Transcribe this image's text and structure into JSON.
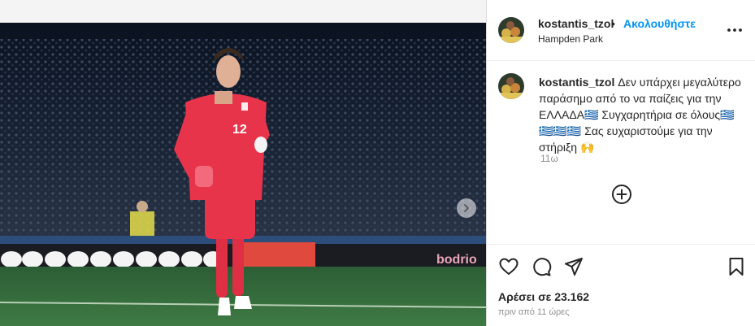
{
  "post": {
    "username": "kostantis_tzol",
    "separator": "•",
    "follow_label": "Ακολουθήστε",
    "location": "Hampden Park"
  },
  "caption": {
    "username": "kostantis_tzol",
    "text": "Δεν υπάρχει μεγαλύτερο παράσημο από το να παίζεις για την ΕΛΛΑΔΑ🇬🇷 Συγχαρητήρια σε όλους🇬🇷🇬🇷🇬🇷🇬🇷 Σας ευχαριστούμε για την στήριξη 🙌",
    "time": "11ω"
  },
  "photo": {
    "jersey_number": "12",
    "ad_text": "bodrio",
    "description_icon": "goalkeeper-photo"
  },
  "actions": {
    "likes": "Αρέσει σε 23.162",
    "posted": "πριν από 11 ώρες"
  },
  "icons": {
    "more": "more-options-icon",
    "add_comment": "add-circle-icon",
    "like": "heart-icon",
    "comment": "comment-icon",
    "share": "share-icon",
    "save": "bookmark-icon",
    "next": "chevron-right-icon"
  },
  "colors": {
    "accent": "#0095f6",
    "jersey": "#e8344a",
    "pitch": "#2f6d3a"
  }
}
